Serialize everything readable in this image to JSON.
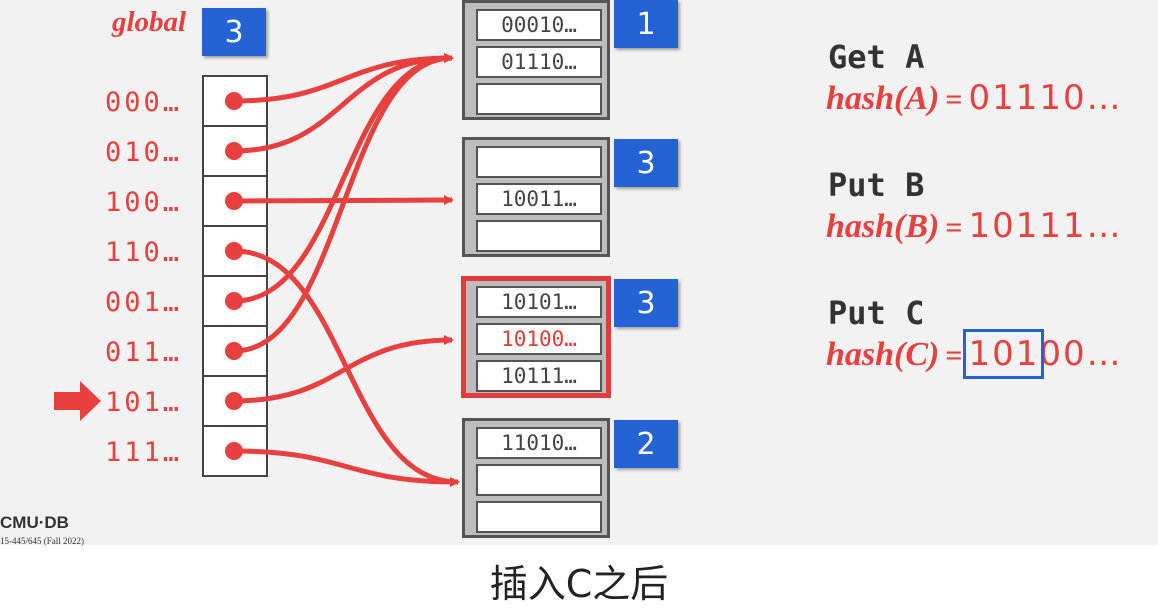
{
  "global": {
    "label": "global",
    "depth": "3"
  },
  "directory": {
    "prefixes": [
      "000…",
      "010…",
      "100…",
      "110…",
      "001…",
      "011…",
      "101…",
      "111…"
    ],
    "current_index": 6
  },
  "buckets": [
    {
      "local_depth": "1",
      "entries": [
        "00010…",
        "01110…",
        ""
      ],
      "active": false,
      "highlight_index": -1
    },
    {
      "local_depth": "3",
      "entries": [
        "",
        "10011…",
        ""
      ],
      "active": false,
      "highlight_index": -1
    },
    {
      "local_depth": "3",
      "entries": [
        "10101…",
        "10100…",
        "10111…"
      ],
      "active": true,
      "highlight_index": 1
    },
    {
      "local_depth": "2",
      "entries": [
        "11010…",
        "",
        ""
      ],
      "active": false,
      "highlight_index": -1
    }
  ],
  "pointers": [
    0,
    0,
    1,
    3,
    0,
    0,
    2,
    3
  ],
  "operations": [
    {
      "title": "Get A",
      "hash_fn": "hash(A)",
      "eq": "=",
      "hash_value_boxed": "",
      "hash_value_rest": "01110…"
    },
    {
      "title": "Put B",
      "hash_fn": "hash(B)",
      "eq": "=",
      "hash_value_boxed": "",
      "hash_value_rest": "10111…"
    },
    {
      "title": "Put C",
      "hash_fn": "hash(C)",
      "eq": "=",
      "hash_value_boxed": "101",
      "hash_value_rest": "00…"
    }
  ],
  "footer": {
    "logo": "CMU·DB",
    "course": "15-445/645 (Fall 2022)"
  },
  "caption": "插入C之后",
  "colors": {
    "accent_red": "#e8403f",
    "blue": "#2563d4",
    "bucket_gray": "#bdbdbd"
  }
}
